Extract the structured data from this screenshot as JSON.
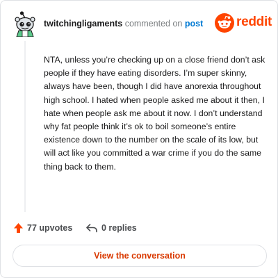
{
  "comment": {
    "author": "twitchingligaments",
    "action_text": "commented on",
    "post_link": "post",
    "body": "NTA, unless you’re checking up on a close friend don’t ask people if they have eating disorders. I’m super skinny, always have been, though I did have anorexia throughout high school. I hated when people asked me about it then, I hate when people ask me about it now. I don’t understand why fat people think it’s ok to boil someone’s entire existence down to the number on the scale of its low, but will act like you committed a war crime if you do the same thing back to them."
  },
  "brand": {
    "name": "reddit",
    "icon": "reddit-logo-icon",
    "color": "#ff4500"
  },
  "stats": {
    "upvotes_label": "77 upvotes",
    "upvote_icon": "upvote-arrow-icon",
    "replies_label": "0 replies",
    "reply_icon": "reply-arrow-icon"
  },
  "cta": {
    "label": "View the conversation"
  },
  "colors": {
    "accent": "#ff4500",
    "link": "#0079d3",
    "cta_text": "#d93900",
    "muted": "#787c7e"
  }
}
